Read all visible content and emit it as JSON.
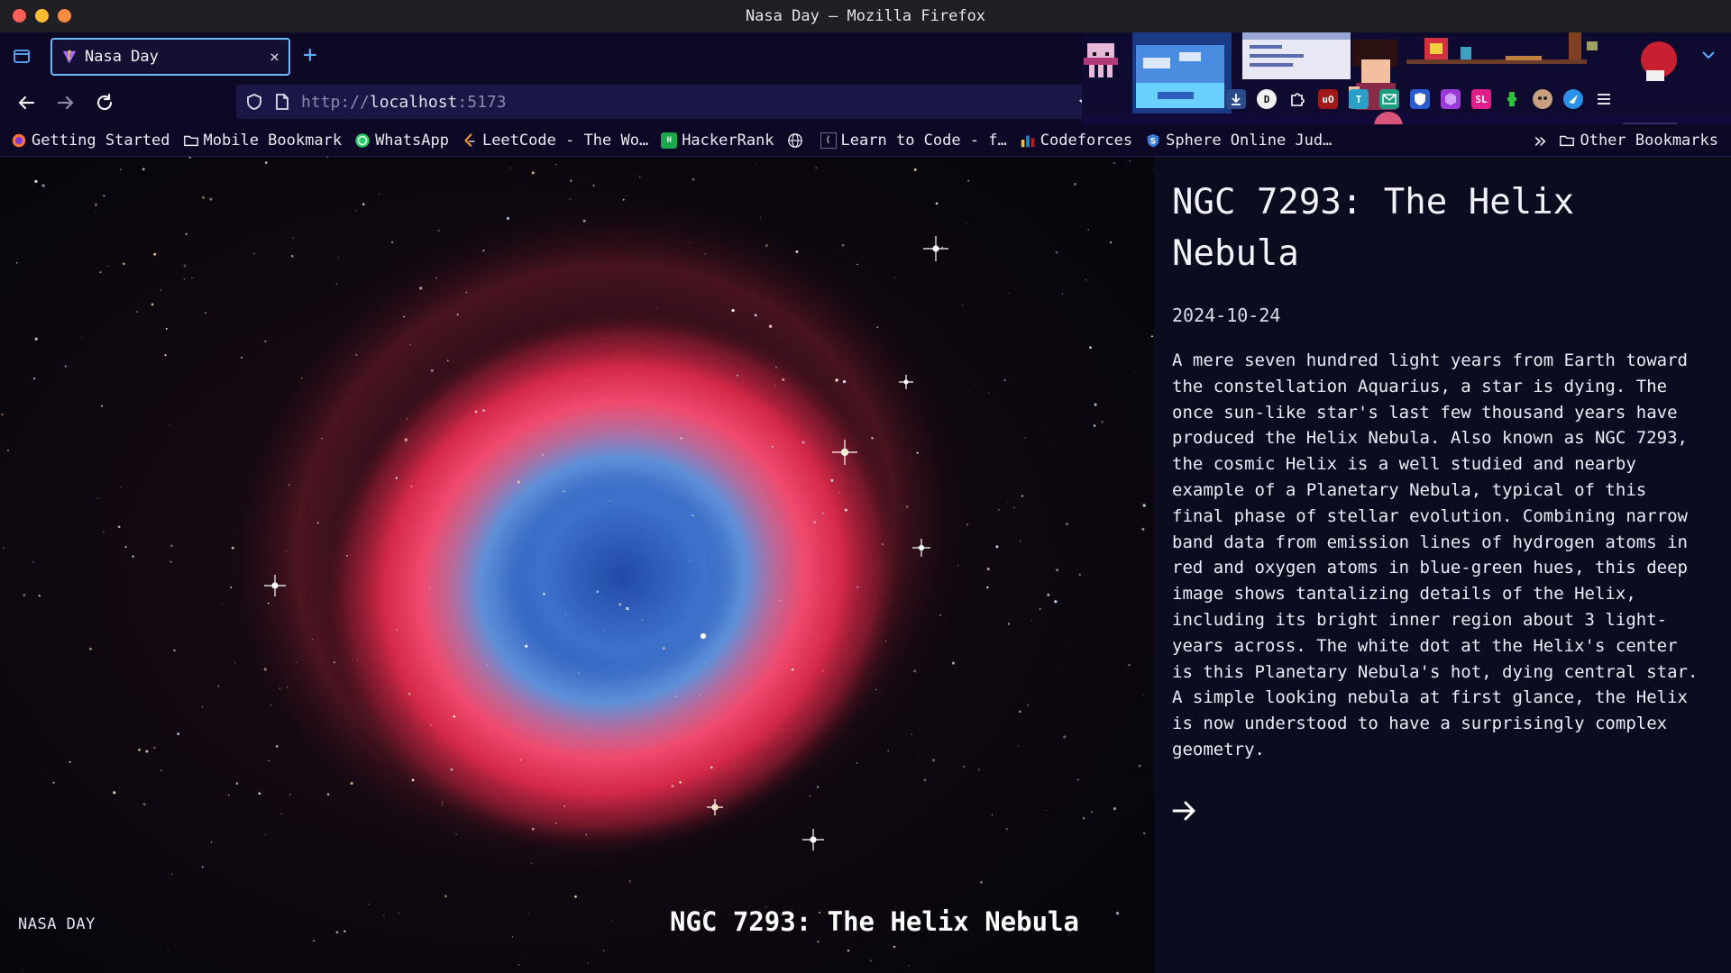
{
  "window": {
    "title": "Nasa Day — Mozilla Firefox"
  },
  "tab": {
    "title": "Nasa Day",
    "close": "×",
    "new_tab": "+"
  },
  "url": {
    "scheme": "http://",
    "host": "localhost",
    "port": ":5173"
  },
  "bookmarks": [
    {
      "label": "Getting Started",
      "icon": "firefox-icon"
    },
    {
      "label": "Mobile Bookmark",
      "icon": "folder-icon"
    },
    {
      "label": "WhatsApp",
      "icon": "whatsapp-icon"
    },
    {
      "label": "LeetCode - The Wo…",
      "icon": "leetcode-icon"
    },
    {
      "label": "HackerRank",
      "icon": "hackerrank-icon"
    },
    {
      "label": "",
      "icon": "globe-icon"
    },
    {
      "label": "Learn to Code - f…",
      "icon": "freecodecamp-icon"
    },
    {
      "label": "Codeforces",
      "icon": "codeforces-icon"
    },
    {
      "label": "Sphere Online Jud…",
      "icon": "spoj-icon"
    }
  ],
  "bookmarks_overflow": "»",
  "other_bookmarks": "Other Bookmarks",
  "extensions": [
    "download-icon",
    "d-extension-icon",
    "puzzle-icon",
    "ublock-icon",
    "tab-extension-icon",
    "mail-icon",
    "shield-extension-icon",
    "hexagon-extension-icon",
    "sl-extension-icon",
    "alien-extension-icon",
    "face-extension-icon",
    "bird-extension-icon",
    "menu-icon"
  ],
  "page": {
    "site_name": "NASA DAY",
    "caption": "NGC 7293: The Helix Nebula",
    "apod": {
      "title": "NGC 7293: The Helix Nebula",
      "date": "2024-10-24",
      "description": "A mere seven hundred light years from Earth toward the constellation Aquarius, a star is dying. The once sun-like star's last few thousand years have produced the Helix Nebula. Also known as NGC 7293, the cosmic Helix is a well studied and nearby example of a Planetary Nebula, typical of this final phase of stellar evolution. Combining narrow band data from emission lines of hydrogen atoms in red and oxygen atoms in blue-green hues, this deep image shows tantalizing details of the Helix, including its bright inner region about 3 light-years across. The white dot at the Helix's center is this Planetary Nebula's hot, dying central star. A simple looking nebula at first glance, the Helix is now understood to have a surprisingly complex geometry."
    },
    "next": "→"
  },
  "colors": {
    "accent": "#6bb8ff",
    "chrome_bg": "#0c0826",
    "nebula_red": "#e8325a",
    "nebula_blue": "#3e7fd0"
  }
}
